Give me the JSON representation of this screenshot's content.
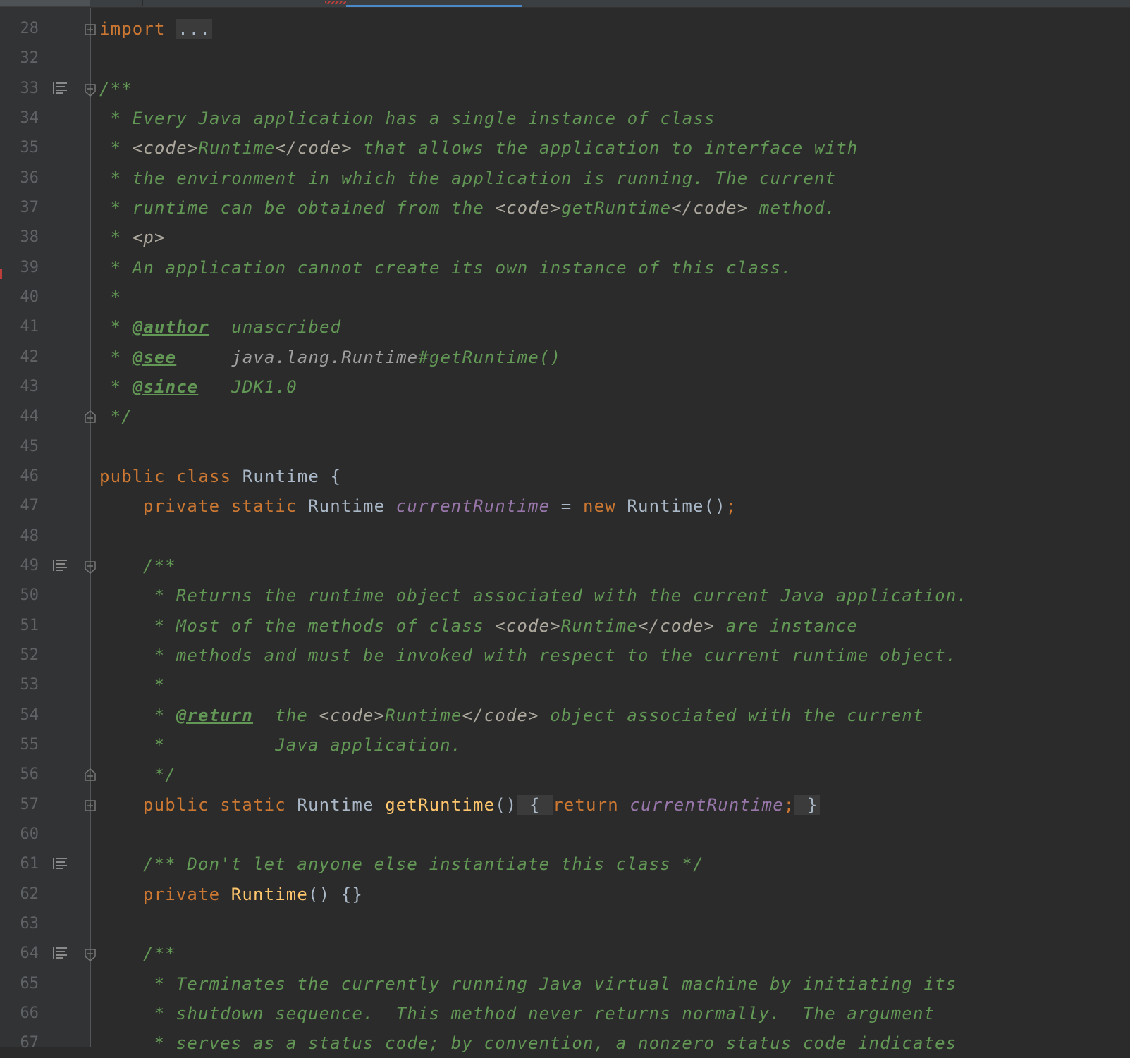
{
  "editor": {
    "lines": [
      {
        "n": "28",
        "icon": false,
        "fold": "collapsed",
        "indent": 0,
        "tokens": [
          {
            "t": "kw",
            "v": "import"
          },
          {
            "t": "plain",
            "v": " "
          },
          {
            "t": "fold-ph",
            "v": "..."
          }
        ]
      },
      {
        "n": "32",
        "icon": false,
        "fold": "",
        "indent": 0,
        "tokens": []
      },
      {
        "n": "33",
        "icon": true,
        "fold": "start",
        "indent": 0,
        "tokens": [
          {
            "t": "cmt",
            "v": "/**"
          }
        ]
      },
      {
        "n": "34",
        "icon": false,
        "fold": "",
        "indent": 0,
        "tokens": [
          {
            "t": "cmt",
            "v": " * Every Java application has a single instance of class"
          }
        ]
      },
      {
        "n": "35",
        "icon": false,
        "fold": "",
        "indent": 0,
        "tokens": [
          {
            "t": "cmt",
            "v": " * "
          },
          {
            "t": "html",
            "v": "<code>"
          },
          {
            "t": "cmt",
            "v": "Runtime"
          },
          {
            "t": "html",
            "v": "</code>"
          },
          {
            "t": "cmt",
            "v": " that allows the application to interface with"
          }
        ]
      },
      {
        "n": "36",
        "icon": false,
        "fold": "",
        "indent": 0,
        "tokens": [
          {
            "t": "cmt",
            "v": " * the environment in which the application is running. The current"
          }
        ]
      },
      {
        "n": "37",
        "icon": false,
        "fold": "",
        "indent": 0,
        "tokens": [
          {
            "t": "cmt",
            "v": " * runtime can be obtained from the "
          },
          {
            "t": "html",
            "v": "<code>"
          },
          {
            "t": "cmt",
            "v": "getRuntime"
          },
          {
            "t": "html",
            "v": "</code>"
          },
          {
            "t": "cmt",
            "v": " method."
          }
        ]
      },
      {
        "n": "38",
        "icon": false,
        "fold": "",
        "indent": 0,
        "tokens": [
          {
            "t": "cmt",
            "v": " * "
          },
          {
            "t": "html",
            "v": "<p>"
          }
        ]
      },
      {
        "n": "39",
        "icon": false,
        "fold": "",
        "indent": 0,
        "tokens": [
          {
            "t": "cmt",
            "v": " * An application cannot create its own instance of this class."
          }
        ]
      },
      {
        "n": "40",
        "icon": false,
        "fold": "",
        "indent": 0,
        "tokens": [
          {
            "t": "cmt",
            "v": " *"
          }
        ]
      },
      {
        "n": "41",
        "icon": false,
        "fold": "",
        "indent": 0,
        "tokens": [
          {
            "t": "cmt",
            "v": " * "
          },
          {
            "t": "tag",
            "v": "@author"
          },
          {
            "t": "cmt",
            "v": "  unascribed"
          }
        ]
      },
      {
        "n": "42",
        "icon": false,
        "fold": "",
        "indent": 0,
        "tokens": [
          {
            "t": "cmt",
            "v": " * "
          },
          {
            "t": "tag",
            "v": "@see"
          },
          {
            "t": "cmt",
            "v": "     "
          },
          {
            "t": "ref",
            "v": "java.lang.Runtime"
          },
          {
            "t": "cmt",
            "v": "#getRuntime()"
          }
        ]
      },
      {
        "n": "43",
        "icon": false,
        "fold": "",
        "indent": 0,
        "tokens": [
          {
            "t": "cmt",
            "v": " * "
          },
          {
            "t": "tag",
            "v": "@since"
          },
          {
            "t": "cmt",
            "v": "   JDK1.0"
          }
        ]
      },
      {
        "n": "44",
        "icon": false,
        "fold": "end",
        "indent": 0,
        "tokens": [
          {
            "t": "cmt",
            "v": " */"
          }
        ]
      },
      {
        "n": "45",
        "icon": false,
        "fold": "",
        "indent": 0,
        "tokens": []
      },
      {
        "n": "46",
        "icon": false,
        "fold": "",
        "indent": 0,
        "tokens": [
          {
            "t": "kw",
            "v": "public class "
          },
          {
            "t": "plain",
            "v": "Runtime {"
          }
        ]
      },
      {
        "n": "47",
        "icon": false,
        "fold": "",
        "indent": 4,
        "tokens": [
          {
            "t": "kw",
            "v": "private static "
          },
          {
            "t": "plain",
            "v": "Runtime "
          },
          {
            "t": "fld",
            "v": "currentRuntime"
          },
          {
            "t": "plain",
            "v": " = "
          },
          {
            "t": "kw",
            "v": "new "
          },
          {
            "t": "plain",
            "v": "Runtime()"
          },
          {
            "t": "kw",
            "v": ";"
          }
        ]
      },
      {
        "n": "48",
        "icon": false,
        "fold": "",
        "indent": 0,
        "tokens": []
      },
      {
        "n": "49",
        "icon": true,
        "fold": "start",
        "indent": 4,
        "tokens": [
          {
            "t": "cmt",
            "v": "/**"
          }
        ]
      },
      {
        "n": "50",
        "icon": false,
        "fold": "",
        "indent": 4,
        "tokens": [
          {
            "t": "cmt",
            "v": " * Returns the runtime object associated with the current Java application."
          }
        ]
      },
      {
        "n": "51",
        "icon": false,
        "fold": "",
        "indent": 4,
        "tokens": [
          {
            "t": "cmt",
            "v": " * Most of the methods of class "
          },
          {
            "t": "html",
            "v": "<code>"
          },
          {
            "t": "cmt",
            "v": "Runtime"
          },
          {
            "t": "html",
            "v": "</code>"
          },
          {
            "t": "cmt",
            "v": " are instance"
          }
        ]
      },
      {
        "n": "52",
        "icon": false,
        "fold": "",
        "indent": 4,
        "tokens": [
          {
            "t": "cmt",
            "v": " * methods and must be invoked with respect to the current runtime object."
          }
        ]
      },
      {
        "n": "53",
        "icon": false,
        "fold": "",
        "indent": 4,
        "tokens": [
          {
            "t": "cmt",
            "v": " *"
          }
        ]
      },
      {
        "n": "54",
        "icon": false,
        "fold": "",
        "indent": 4,
        "tokens": [
          {
            "t": "cmt",
            "v": " * "
          },
          {
            "t": "tag",
            "v": "@return"
          },
          {
            "t": "cmt",
            "v": "  the "
          },
          {
            "t": "html",
            "v": "<code>"
          },
          {
            "t": "cmt",
            "v": "Runtime"
          },
          {
            "t": "html",
            "v": "</code>"
          },
          {
            "t": "cmt",
            "v": " object associated with the current"
          }
        ]
      },
      {
        "n": "55",
        "icon": false,
        "fold": "",
        "indent": 4,
        "tokens": [
          {
            "t": "cmt",
            "v": " *          Java application."
          }
        ]
      },
      {
        "n": "56",
        "icon": false,
        "fold": "end",
        "indent": 4,
        "tokens": [
          {
            "t": "cmt",
            "v": " */"
          }
        ]
      },
      {
        "n": "57",
        "icon": false,
        "fold": "collapsed",
        "indent": 4,
        "tokens": [
          {
            "t": "kw",
            "v": "public static "
          },
          {
            "t": "plain",
            "v": "Runtime "
          },
          {
            "t": "fn",
            "v": "getRuntime"
          },
          {
            "t": "plain",
            "v": "()"
          },
          {
            "t": "fold-ph",
            "v": " { "
          },
          {
            "t": "kw",
            "v": "return "
          },
          {
            "t": "fld",
            "v": "currentRuntime"
          },
          {
            "t": "kw",
            "v": ";"
          },
          {
            "t": "fold-ph",
            "v": " }"
          }
        ]
      },
      {
        "n": "60",
        "icon": false,
        "fold": "",
        "indent": 0,
        "tokens": []
      },
      {
        "n": "61",
        "icon": true,
        "fold": "",
        "indent": 4,
        "tokens": [
          {
            "t": "cmt",
            "v": "/** Don't let anyone else instantiate this class */"
          }
        ]
      },
      {
        "n": "62",
        "icon": false,
        "fold": "",
        "indent": 4,
        "tokens": [
          {
            "t": "kw",
            "v": "private "
          },
          {
            "t": "fn",
            "v": "Runtime"
          },
          {
            "t": "plain",
            "v": "() {}"
          }
        ]
      },
      {
        "n": "63",
        "icon": false,
        "fold": "",
        "indent": 0,
        "tokens": []
      },
      {
        "n": "64",
        "icon": true,
        "fold": "start",
        "indent": 4,
        "tokens": [
          {
            "t": "cmt",
            "v": "/**"
          }
        ]
      },
      {
        "n": "65",
        "icon": false,
        "fold": "",
        "indent": 4,
        "tokens": [
          {
            "t": "cmt",
            "v": " * Terminates the currently running Java virtual machine by initiating its"
          }
        ]
      },
      {
        "n": "66",
        "icon": false,
        "fold": "",
        "indent": 4,
        "tokens": [
          {
            "t": "cmt",
            "v": " * shutdown sequence.  This method never returns normally.  The argument"
          }
        ]
      },
      {
        "n": "67",
        "icon": false,
        "fold": "",
        "indent": 4,
        "tokens": [
          {
            "t": "cmt",
            "v": " * serves as a status code; by convention, a nonzero status code indicates"
          }
        ]
      }
    ]
  }
}
